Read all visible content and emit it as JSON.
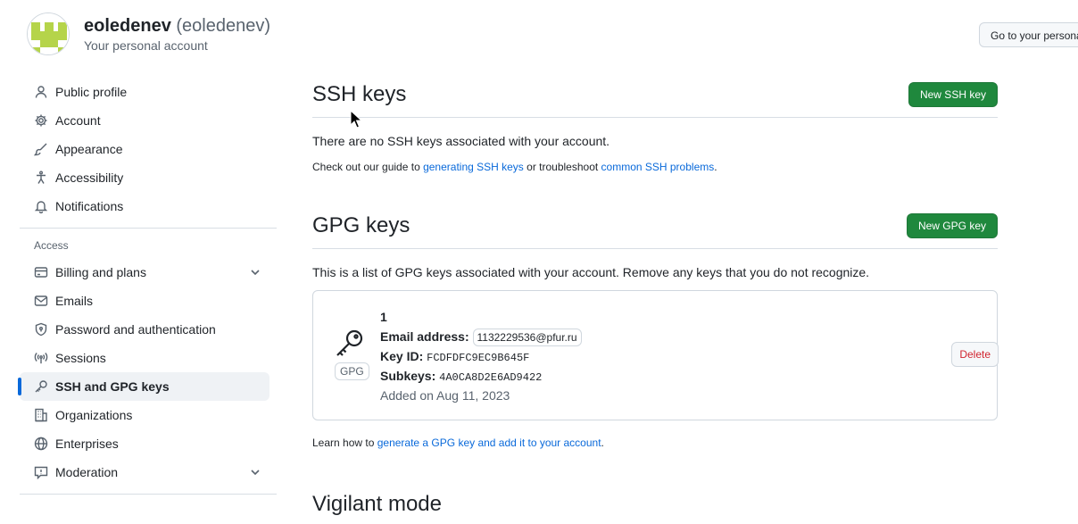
{
  "profile": {
    "name": "eoledenev",
    "login": "(eoledenev)",
    "subtitle": "Your personal account",
    "goto_button": "Go to your personal profile"
  },
  "sidebar": {
    "items_top": [
      {
        "label": "Public profile",
        "icon": "person-icon"
      },
      {
        "label": "Account",
        "icon": "gear-icon"
      },
      {
        "label": "Appearance",
        "icon": "paintbrush-icon"
      },
      {
        "label": "Accessibility",
        "icon": "accessibility-icon"
      },
      {
        "label": "Notifications",
        "icon": "bell-icon"
      }
    ],
    "access_label": "Access",
    "items_access": [
      {
        "label": "Billing and plans",
        "icon": "credit-card-icon"
      },
      {
        "label": "Emails",
        "icon": "mail-icon"
      },
      {
        "label": "Password and authentication",
        "icon": "shield-lock-icon"
      },
      {
        "label": "Sessions",
        "icon": "broadcast-icon"
      },
      {
        "label": "SSH and GPG keys",
        "icon": "key-icon"
      },
      {
        "label": "Organizations",
        "icon": "organization-icon"
      },
      {
        "label": "Enterprises",
        "icon": "globe-icon"
      },
      {
        "label": "Moderation",
        "icon": "report-icon"
      }
    ]
  },
  "ssh": {
    "title": "SSH keys",
    "new_button": "New SSH key",
    "empty_text": "There are no SSH keys associated with your account.",
    "note_prefix": "Check out our guide to ",
    "note_link1": "generating SSH keys",
    "note_middle": " or troubleshoot ",
    "note_link2": "common SSH problems",
    "note_suffix": "."
  },
  "gpg": {
    "title": "GPG keys",
    "new_button": "New GPG key",
    "intro": "This is a list of GPG keys associated with your account. Remove any keys that you do not recognize.",
    "badge": "GPG",
    "key": {
      "name": "1",
      "email_label": "Email address:",
      "email": "1132229536@pfur.ru",
      "keyid_label": "Key ID:",
      "keyid": "FCDFDFC9EC9B645F",
      "subkeys_label": "Subkeys:",
      "subkeys": "4A0CA8D2E6AD9422",
      "added": "Added on Aug 11, 2023"
    },
    "delete_button": "Delete",
    "learn_prefix": "Learn how to ",
    "learn_link": "generate a GPG key and add it to your account",
    "learn_suffix": "."
  },
  "vigilant": {
    "title": "Vigilant mode"
  },
  "colors": {
    "primary_button": "#1f883d",
    "link": "#0969da",
    "danger": "#d1242f",
    "active_indicator": "#0969da"
  }
}
